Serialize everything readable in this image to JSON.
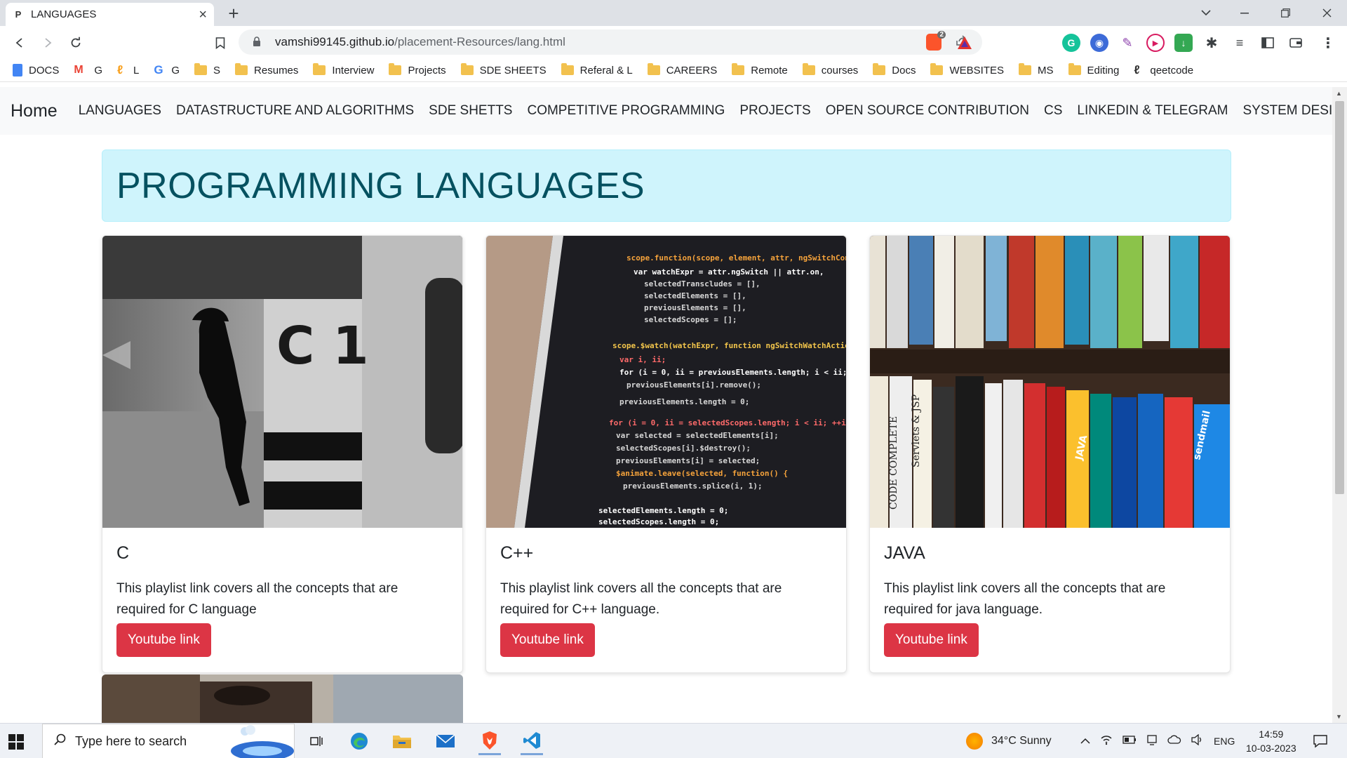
{
  "browser": {
    "tab_favicon": "P",
    "tab_title": "LANGUAGES",
    "url_host": "vamshi99145.github.io",
    "url_path": "/placement-Resources/lang.html",
    "ext_badge": "2"
  },
  "bookmarks": [
    {
      "label": "DOCS",
      "icon": "docs-icon"
    },
    {
      "label": "G",
      "icon": "gmail-icon"
    },
    {
      "label": "L",
      "icon": "leetcode-icon"
    },
    {
      "label": "G",
      "icon": "google-icon"
    },
    {
      "label": "S",
      "icon": "folder-icon"
    },
    {
      "label": "Resumes",
      "icon": "folder-icon"
    },
    {
      "label": "Interview",
      "icon": "folder-icon"
    },
    {
      "label": "Projects",
      "icon": "folder-icon"
    },
    {
      "label": "SDE SHEETS",
      "icon": "folder-icon"
    },
    {
      "label": "Referal & L",
      "icon": "folder-icon"
    },
    {
      "label": "CAREERS",
      "icon": "folder-icon"
    },
    {
      "label": "Remote",
      "icon": "folder-icon"
    },
    {
      "label": "courses",
      "icon": "folder-icon"
    },
    {
      "label": "Docs",
      "icon": "folder-icon"
    },
    {
      "label": "WEBSITES",
      "icon": "folder-icon"
    },
    {
      "label": "MS",
      "icon": "folder-icon"
    },
    {
      "label": "Editing",
      "icon": "folder-icon"
    },
    {
      "label": "qeetcode",
      "icon": "leetcode-icon"
    }
  ],
  "navbar": {
    "brand": "Home",
    "links": [
      "LANGUAGES",
      "DATASTRUCTURE AND ALGORITHMS",
      "SDE SHETTS",
      "COMPETITIVE PROGRAMMING",
      "PROJECTS",
      "OPEN SOURCE CONTRIBUTION",
      "CS",
      "LINKEDIN & TELEGRAM",
      "SYSTEM DESIGN"
    ]
  },
  "heading": "PROGRAMMING LANGUAGES",
  "cards": [
    {
      "title": "C",
      "text": "This playlist link covers all the concepts that are required for C language",
      "button": "Youtube link"
    },
    {
      "title": "C++",
      "text": "This playlist link covers all the concepts that are required for C++ language.",
      "button": "Youtube link"
    },
    {
      "title": "JAVA",
      "text": "This playlist link covers all the concepts that are required for java language.",
      "button": "Youtube link"
    }
  ],
  "taskbar": {
    "search_placeholder": "Type here to search",
    "weather": "34°C  Sunny",
    "lang": "ENG",
    "time": "14:59",
    "date": "10-03-2023"
  },
  "colors": {
    "alert_bg": "#cff4fc",
    "alert_text": "#055160",
    "button_bg": "#dc3545",
    "navbar_bg": "#f8f9fa"
  }
}
